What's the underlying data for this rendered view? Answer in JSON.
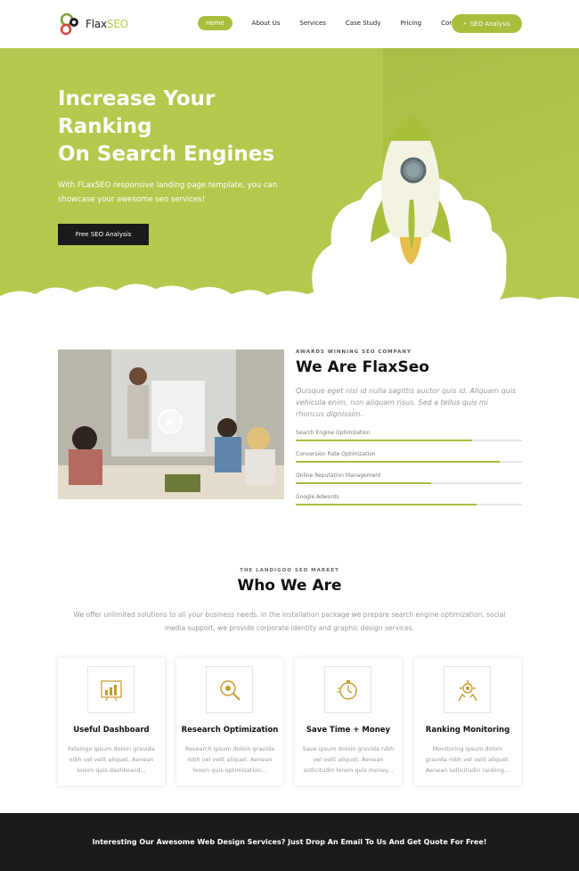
{
  "header": {
    "logo_prefix": "Flax",
    "logo_suffix": "SEO",
    "nav": [
      "Home",
      "About Us",
      "Services",
      "Case Study",
      "Pricing",
      "Contact"
    ],
    "cta_label": "SEO Analysis"
  },
  "hero": {
    "title_lines": [
      "Increase Your",
      "Ranking",
      "On Search Engines"
    ],
    "subtitle": "With FLaxSEO responsive landing page template, you can showcase your awesome seo services!",
    "button_label": "Free SEO Analysis"
  },
  "about": {
    "kicker": "AWARDS WINNING SEO COMPANY",
    "title": "We Are FlaxSeo",
    "text": "Quisque eget nisl id nulla sagittis auctor quis id. Aliquam quis vehicula enim, non aliquam risus. Sed a tellus quis mi rhoncus dignissim.",
    "skills": [
      {
        "label": "Search Engine Optimization",
        "value": 78
      },
      {
        "label": "Conversion Rate Optimization",
        "value": 90
      },
      {
        "label": "Online Reputation Management",
        "value": 60
      },
      {
        "label": "Google Adwords",
        "value": 80
      }
    ]
  },
  "who": {
    "kicker": "THE LANDIGOO SEO MARKET",
    "title": "Who We Are",
    "text": "We offer unlimited solutions to all your business needs. in the installation package we prepare search engine optimization, social media support, we provide corporate identity and graphic design services."
  },
  "features": [
    {
      "icon": "chart-icon",
      "title": "Useful Dashboard",
      "text": "Felaingo ipsum doloin gravida nibh vel velit aliquet. Aenean lorem quis dashboard..."
    },
    {
      "icon": "search-gear-icon",
      "title": "Research Optimization",
      "text": "Research ipsum doloin gravida nibh vel velit aliquet. Aenean lorem quis optimization..."
    },
    {
      "icon": "stopwatch-icon",
      "title": "Save Time + Money",
      "text": "Save ipsum doloin gravida nibh vel velit aliquet. Aenean sollicitudin lorem quis money..."
    },
    {
      "icon": "monitoring-icon",
      "title": "Ranking Monitoring",
      "text": "Monitoring ipsum doloin gravida nibh vel velit aliquet. Aenean sollicitudin ranking..."
    }
  ],
  "footer": {
    "text": "Interesting Our Awesome Web Design Services? Just Drop An Email To Us And Get Quote For Free!"
  },
  "colors": {
    "accent": "#a8bf3c",
    "hero_bg": "#b5c84d",
    "dark": "#1b1b1b"
  }
}
